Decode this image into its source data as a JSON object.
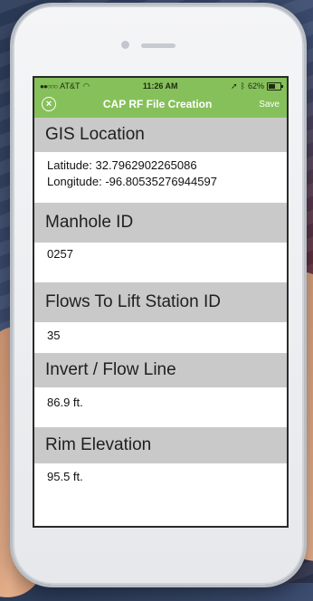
{
  "status_bar": {
    "carrier": "AT&T",
    "time": "11:26 AM",
    "battery": "62%",
    "battery_level": 0.62
  },
  "nav": {
    "title": "CAP RF File Creation",
    "save_label": "Save"
  },
  "sections": {
    "gis": {
      "header": "GIS Location",
      "latitude": "Latitude: 32.7962902265086",
      "longitude": "Longitude: -96.80535276944597"
    },
    "manhole": {
      "header": "Manhole ID",
      "value": "0257"
    },
    "flows": {
      "header": "Flows To Lift Station ID",
      "value": "35"
    },
    "invert": {
      "header": "Invert / Flow Line",
      "value": "86.9 ft."
    },
    "rim": {
      "header": "Rim Elevation",
      "value": "95.5 ft."
    }
  },
  "colors": {
    "accent": "#86c05a",
    "section_header_bg": "#c9c9c9"
  }
}
